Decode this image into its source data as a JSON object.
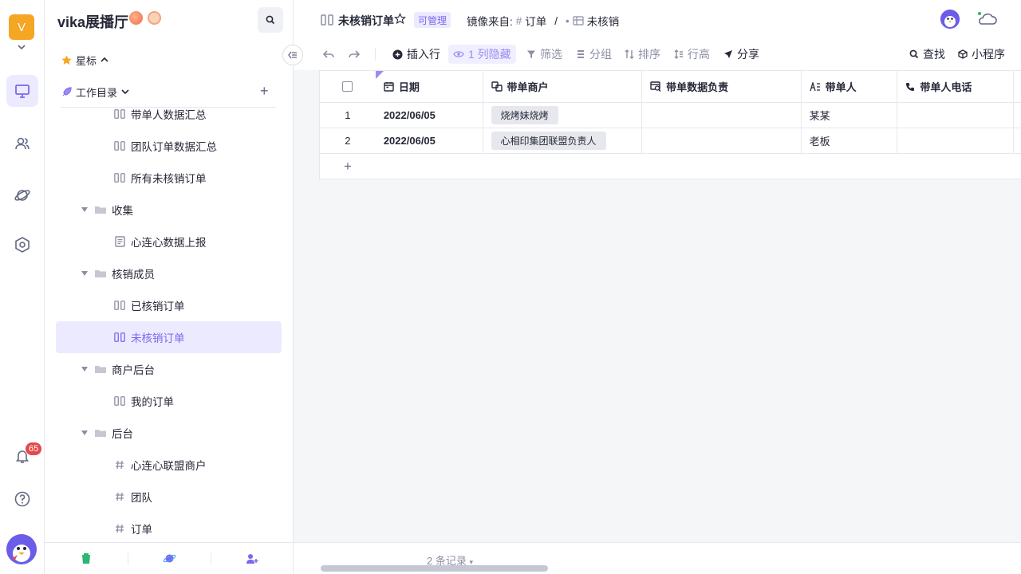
{
  "rail": {
    "space_initial": "V",
    "notification_count": "65"
  },
  "sidebar": {
    "space_name": "vika展播厅",
    "starred_label": "星标",
    "catalog_label": "工作目录",
    "tree": [
      {
        "type": "leaf",
        "icon": "datasheet-icon",
        "label": "带单人数据汇总"
      },
      {
        "type": "leaf",
        "icon": "datasheet-icon",
        "label": "团队订单数据汇总"
      },
      {
        "type": "leaf",
        "icon": "datasheet-icon",
        "label": "所有未核销订单"
      },
      {
        "type": "folder",
        "label": "收集"
      },
      {
        "type": "leaf",
        "icon": "form-icon",
        "label": "心连心数据上报"
      },
      {
        "type": "folder",
        "label": "核销成员"
      },
      {
        "type": "leaf",
        "icon": "datasheet-icon",
        "label": "已核销订单"
      },
      {
        "type": "leaf",
        "icon": "datasheet-icon",
        "label": "未核销订单",
        "selected": true
      },
      {
        "type": "folder",
        "label": "商户后台"
      },
      {
        "type": "leaf",
        "icon": "datasheet-icon",
        "label": "我的订单"
      },
      {
        "type": "folder",
        "label": "后台"
      },
      {
        "type": "leaf",
        "icon": "hash-icon",
        "label": "心连心联盟商户"
      },
      {
        "type": "leaf",
        "icon": "hash-icon",
        "label": "团队"
      },
      {
        "type": "leaf",
        "icon": "hash-icon",
        "label": "订单"
      }
    ]
  },
  "topbar": {
    "title": "未核销订单",
    "role_badge": "可管理",
    "mirror_prefix": "镜像来自:",
    "mirror_source": "订单",
    "mirror_sep": "/",
    "mirror_view": "未核销"
  },
  "toolbar": {
    "insert_row": "插入行",
    "hidden_cols": "1 列隐藏",
    "filter": "筛选",
    "group": "分组",
    "sort": "排序",
    "row_height": "行高",
    "share": "分享",
    "find": "查找",
    "widget": "小程序"
  },
  "grid": {
    "columns": [
      "日期",
      "带单商户",
      "带单数据负责",
      "带单人",
      "带单人电话"
    ],
    "rows": [
      {
        "index": "1",
        "date": "2022/06/05",
        "merchant": "烧烤妹烧烤",
        "data_owner": "",
        "leader": "某某",
        "phone": ""
      },
      {
        "index": "2",
        "date": "2022/06/05",
        "merchant": "心相印集团联盟负责人",
        "data_owner": "",
        "leader": "老板",
        "phone": ""
      }
    ],
    "add_symbol": "+"
  },
  "status": {
    "records": "2 条记录"
  },
  "colors": {
    "accent": "#7b67ee",
    "accent_bg": "#eceaff",
    "space_avatar": "#f5a623",
    "badge_red": "#e5484d"
  }
}
